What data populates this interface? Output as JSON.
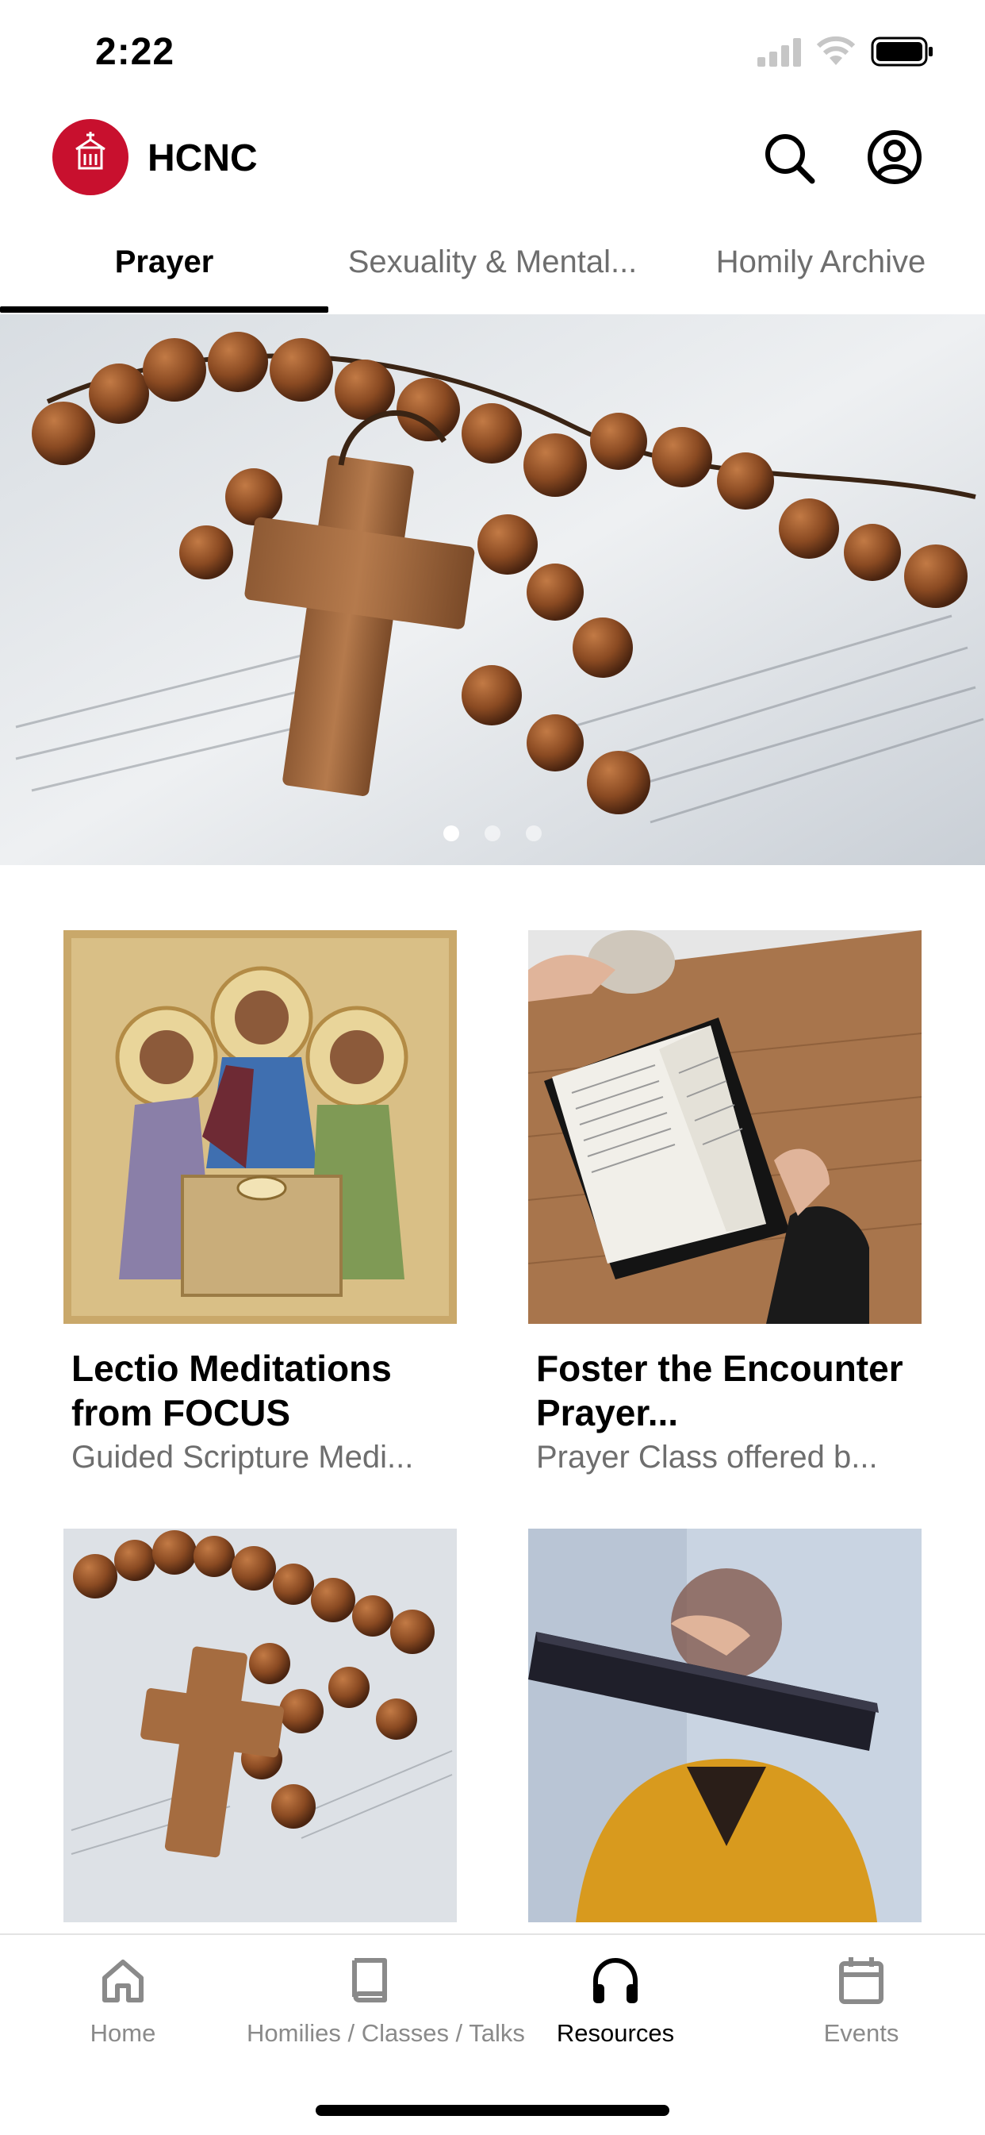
{
  "status_bar": {
    "time": "2:22"
  },
  "header": {
    "app_title": "HCNC"
  },
  "colors": {
    "brand": "#c8102e",
    "tab_active": "#000000",
    "inactive_text": "#6e6e6e"
  },
  "tabs": [
    {
      "label": "Prayer",
      "active": true
    },
    {
      "label": "Sexuality & Mental...",
      "active": false
    },
    {
      "label": "Homily Archive",
      "active": false
    }
  ],
  "carousel": {
    "slide_count": 3,
    "active_index": 0
  },
  "cards": [
    {
      "title": "Lectio Meditations from FOCUS",
      "subtitle": "Guided Scripture Medi...",
      "image": "icon-trinity-image"
    },
    {
      "title": "Foster the Encounter Prayer...",
      "subtitle": "Prayer Class offered b...",
      "image": "open-bible-image"
    },
    {
      "title": "",
      "subtitle": "",
      "image": "rosary-image"
    },
    {
      "title": "",
      "subtitle": "",
      "image": "holy-bible-image"
    }
  ],
  "bottom_nav": [
    {
      "label": "Home",
      "icon": "home-icon",
      "active": false
    },
    {
      "label": "Homilies / Classes / Talks",
      "icon": "book-icon",
      "active": false
    },
    {
      "label": "Resources",
      "icon": "headphones-icon",
      "active": true
    },
    {
      "label": "Events",
      "icon": "calendar-icon",
      "active": false
    }
  ]
}
